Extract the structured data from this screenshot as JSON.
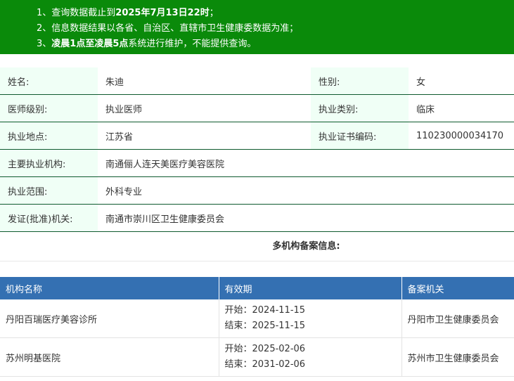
{
  "notice": {
    "line1_prefix": "1、查询数据截止到",
    "line1_bold": "2025年7月13日22时",
    "line1_suffix": "；",
    "line2": "2、信息数据结果以各省、自治区、直辖市卫生健康委数据为准；",
    "line3_prefix": "3、",
    "line3_bold": "凌晨1点至凌晨5点",
    "line3_suffix": "系统进行维护，不能提供查询。"
  },
  "info": {
    "name_label": "姓名:",
    "name_value": "朱迪",
    "gender_label": "性别:",
    "gender_value": "女",
    "level_label": "医师级别:",
    "level_value": "执业医师",
    "category_label": "执业类别:",
    "category_value": "临床",
    "location_label": "执业地点:",
    "location_value": "江苏省",
    "cert_label": "执业证书编码:",
    "cert_value": "110230000034170",
    "institution_label": "主要执业机构:",
    "institution_value": "南通俪人连天美医疗美容医院",
    "scope_label": "执业范围:",
    "scope_value": "外科专业",
    "authority_label": "发证(批准)机关:",
    "authority_value": "南通市崇川区卫生健康委员会"
  },
  "multi_title": "多机构备案信息:",
  "org_table": {
    "headers": [
      "机构名称",
      "有效期",
      "备案机关"
    ],
    "rows": [
      {
        "name": "丹阳百瑞医疗美容诊所",
        "start": "开始：2024-11-15",
        "end": "结束：2025-11-15",
        "authority": "丹阳市卫生健康委员会"
      },
      {
        "name": "苏州明基医院",
        "start": "开始：2025-02-06",
        "end": "结束：2031-02-06",
        "authority": "苏州市卫生健康委员会"
      }
    ]
  }
}
